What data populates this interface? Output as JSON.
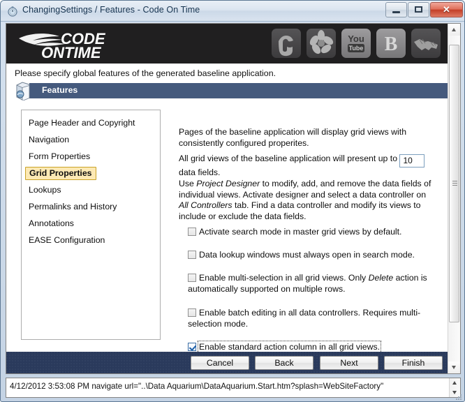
{
  "window": {
    "title": "ChangingSettings / Features - Code On Time",
    "title_icon": "stopwatch-icon",
    "controls": {
      "minimize_label": "–",
      "maximize_label": "□",
      "close_label": "✕"
    }
  },
  "banner": {
    "logo_line1": "CODE",
    "logo_line2": "ON TIME",
    "social_icons": [
      {
        "name": "stumbleupon-icon",
        "label": "StumbleUpon"
      },
      {
        "name": "flickr-icon",
        "label": "Flickr"
      },
      {
        "name": "youtube-icon",
        "label": "YouTube",
        "text_top": "You",
        "text_bottom": "Tube"
      },
      {
        "name": "blogger-icon",
        "label": "Blogger",
        "glyph": "B"
      },
      {
        "name": "handshake-icon",
        "label": "Partners"
      }
    ]
  },
  "instruction": "Please specify global features of the generated baseline application.",
  "section": {
    "icon": "package-icon",
    "title": "Features"
  },
  "nav": {
    "items": [
      {
        "label": "Page Header and Copyright",
        "selected": false
      },
      {
        "label": "Navigation",
        "selected": false
      },
      {
        "label": "Form Properties",
        "selected": false
      },
      {
        "label": "Grid Properties",
        "selected": true
      },
      {
        "label": "Lookups",
        "selected": false
      },
      {
        "label": "Permalinks and History",
        "selected": false
      },
      {
        "label": "Annotations",
        "selected": false
      },
      {
        "label": "EASE Configuration",
        "selected": false
      }
    ]
  },
  "panel": {
    "paragraph1": "Pages of the baseline application will display grid views with consistently configured properites.",
    "field_sentence_before": "All grid views of the baseline application will present up to",
    "data_fields_value": "10",
    "field_sentence_after": "data fields.",
    "paragraph3_part1": "Use ",
    "paragraph3_em1": "Project Designer",
    "paragraph3_part2": " to modify, add, and remove the data fields of individual views. Activate designer and select a data controller on ",
    "paragraph3_em2": "All Controllers",
    "paragraph3_part3": " tab. Find a data controller and modify its views to include or exclude the data fields.",
    "checkboxes": [
      {
        "label": "Activate search mode in master grid views by default.",
        "checked": false,
        "focused": false
      },
      {
        "label": "Data lookup windows must always open in search mode.",
        "checked": false,
        "focused": false
      },
      {
        "label_part1": "Enable multi-selection in all grid views. Only ",
        "label_em": "Delete",
        "label_part2": " action is automatically supported on multiple rows.",
        "checked": false,
        "focused": false
      },
      {
        "label": "Enable batch editing in all data controllers. Requires multi-selection mode.",
        "checked": false,
        "focused": false
      },
      {
        "label": "Enable standard action column in all grid views.",
        "checked": true,
        "focused": true
      }
    ]
  },
  "footer": {
    "buttons": [
      {
        "label": "Cancel",
        "name": "cancel-button"
      },
      {
        "label": "Back",
        "name": "back-button"
      },
      {
        "label": "Next",
        "name": "next-button"
      },
      {
        "label": "Finish",
        "name": "finish-button"
      }
    ]
  },
  "statusbar": {
    "text": "4/12/2012 3:53:08 PM navigate url=\"..\\Data Aquarium\\DataAquarium.Start.htm?splash=WebSiteFactory\""
  },
  "colors": {
    "section_header": "#455a7d",
    "footer_bar": "#2a3a5c",
    "banner": "#201f20",
    "selected_nav_bg": "#fde9b4",
    "selected_nav_border": "#c9a227",
    "checkbox_check": "#1b5ea8"
  }
}
